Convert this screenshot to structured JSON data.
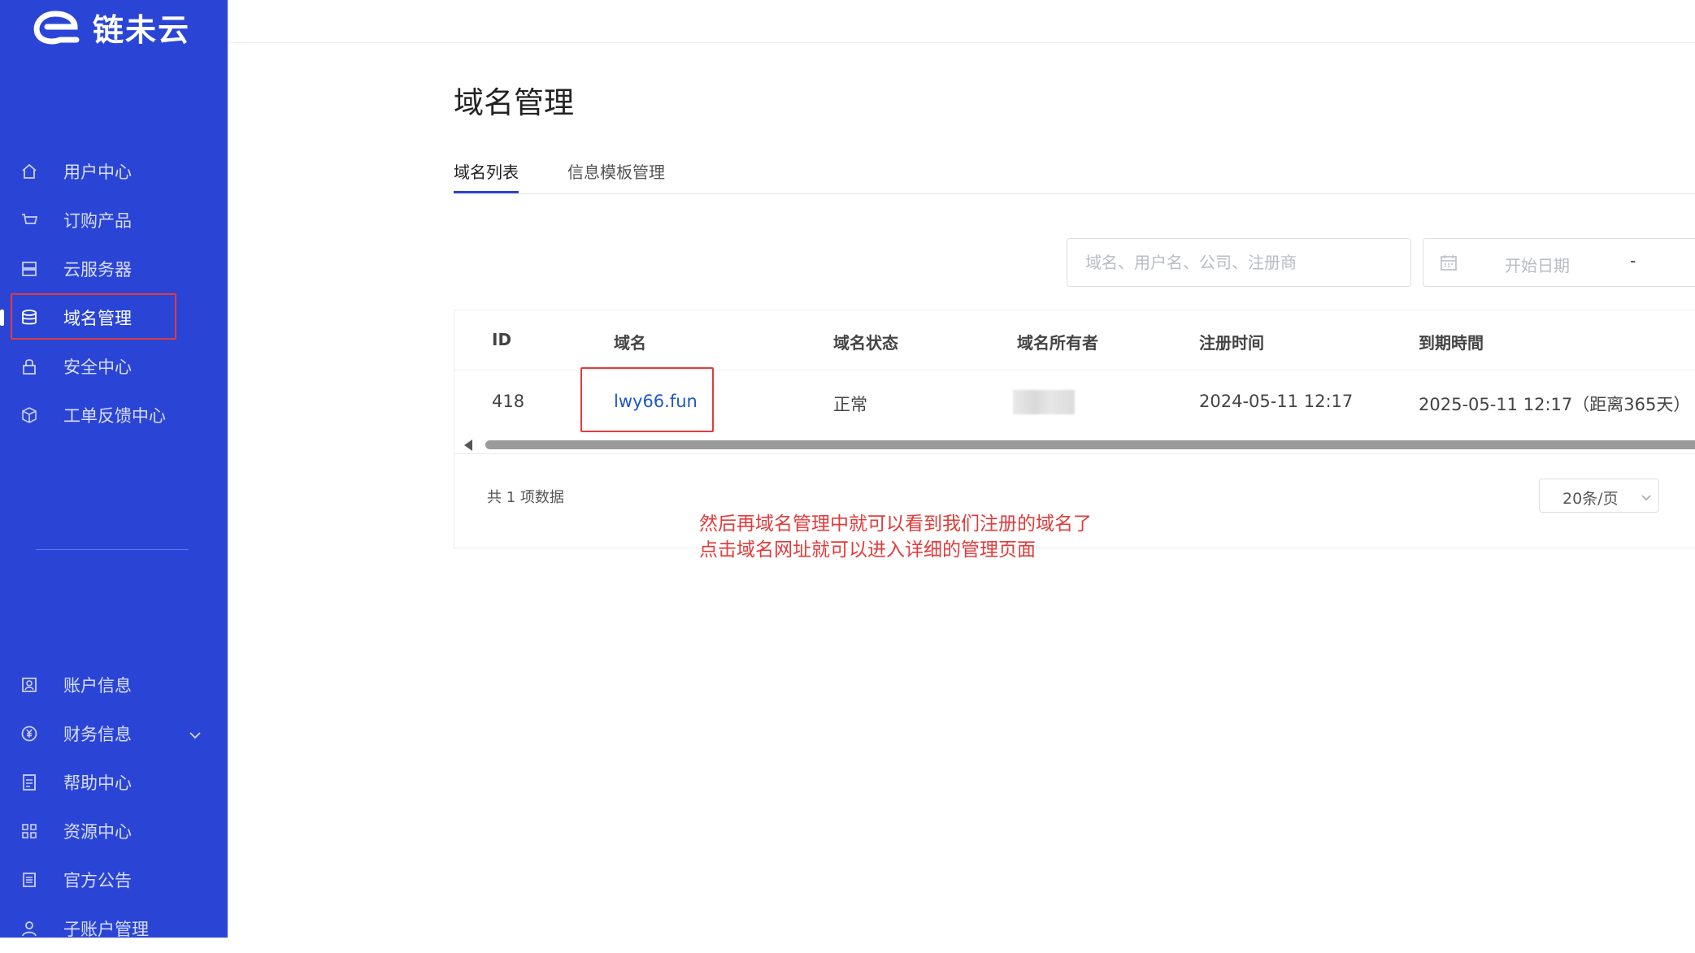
{
  "brand": {
    "name": "链未云"
  },
  "sidebar": {
    "items": [
      {
        "label": "用户中心",
        "icon": "home-icon"
      },
      {
        "label": "订购产品",
        "icon": "cart-icon"
      },
      {
        "label": "云服务器",
        "icon": "server-icon"
      },
      {
        "label": "域名管理",
        "icon": "database-icon",
        "active": true
      },
      {
        "label": "安全中心",
        "icon": "lock-icon"
      },
      {
        "label": "工单反馈中心",
        "icon": "cube-icon"
      }
    ],
    "bottom_items": [
      {
        "label": "账户信息",
        "icon": "user-card-icon"
      },
      {
        "label": "财务信息",
        "icon": "yuan-icon",
        "expandable": true
      },
      {
        "label": "帮助中心",
        "icon": "doc-icon"
      },
      {
        "label": "资源中心",
        "icon": "grid-icon"
      },
      {
        "label": "官方公告",
        "icon": "notice-icon"
      },
      {
        "label": "子账户管理",
        "icon": "sub-account-icon"
      }
    ]
  },
  "main": {
    "title": "域名管理",
    "tabs": [
      {
        "label": "域名列表",
        "active": true
      },
      {
        "label": "信息模板管理",
        "active": false
      }
    ],
    "search": {
      "placeholder": "域名、用户名、公司、注册商"
    },
    "date_range": {
      "start_placeholder": "开始日期",
      "separator": "-"
    },
    "table": {
      "columns": [
        "ID",
        "域名",
        "域名状态",
        "域名所有者",
        "注册时间",
        "到期時間"
      ],
      "rows": [
        {
          "id": "418",
          "domain": "lwy66.fun",
          "status": "正常",
          "owner": "",
          "registered": "2024-05-11 12:17",
          "expires": "2025-05-11 12:17（距离365天）"
        }
      ]
    },
    "total_text": "共 1 项数据",
    "page_size": "20条/页"
  },
  "annotation": {
    "line1": "然后再域名管理中就可以看到我们注册的域名了",
    "line2": "点击域名网址就可以进入详细的管理页面"
  },
  "colors": {
    "sidebar_bg": "#2a45d6",
    "link": "#1e56c8",
    "highlight": "#e23b3b"
  }
}
